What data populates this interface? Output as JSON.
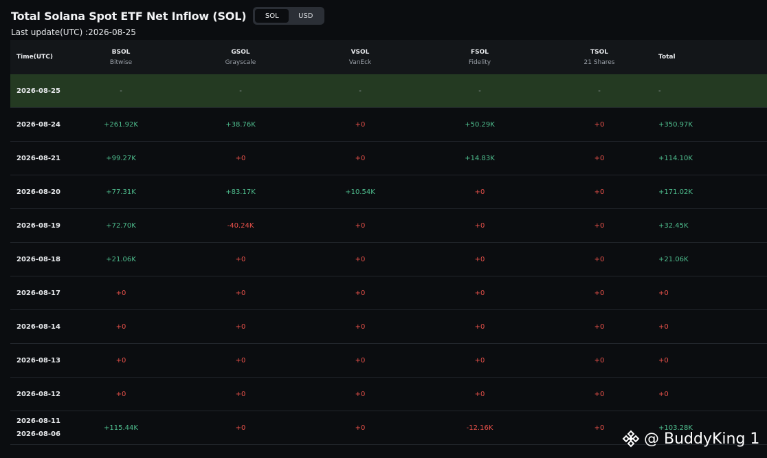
{
  "header": {
    "title": "Total Solana Spot ETF Net Inflow (SOL)",
    "toggle": [
      "SOL",
      "USD"
    ],
    "active_toggle": "SOL",
    "last_update": "Last update(UTC) :2026-08-25"
  },
  "table": {
    "columns": [
      {
        "ticker": "Time(UTC)",
        "issuer": ""
      },
      {
        "ticker": "BSOL",
        "issuer": "Bitwise"
      },
      {
        "ticker": "GSOL",
        "issuer": "Grayscale"
      },
      {
        "ticker": "VSOL",
        "issuer": "VanEck"
      },
      {
        "ticker": "FSOL",
        "issuer": "Fidelity"
      },
      {
        "ticker": "TSOL",
        "issuer": "21 Shares"
      },
      {
        "ticker": "Total",
        "issuer": ""
      }
    ],
    "rows": [
      {
        "date": "2026-08-25",
        "date2": "",
        "values": [
          "-",
          "-",
          "-",
          "-",
          "-",
          "-"
        ],
        "highlight": true
      },
      {
        "date": "2026-08-24",
        "date2": "",
        "values": [
          "+261.92K",
          "+38.76K",
          "+0",
          "+50.29K",
          "+0",
          "+350.97K"
        ]
      },
      {
        "date": "2026-08-21",
        "date2": "",
        "values": [
          "+99.27K",
          "+0",
          "+0",
          "+14.83K",
          "+0",
          "+114.10K"
        ]
      },
      {
        "date": "2026-08-20",
        "date2": "",
        "values": [
          "+77.31K",
          "+83.17K",
          "+10.54K",
          "+0",
          "+0",
          "+171.02K"
        ]
      },
      {
        "date": "2026-08-19",
        "date2": "",
        "values": [
          "+72.70K",
          "-40.24K",
          "+0",
          "+0",
          "+0",
          "+32.45K"
        ]
      },
      {
        "date": "2026-08-18",
        "date2": "",
        "values": [
          "+21.06K",
          "+0",
          "+0",
          "+0",
          "+0",
          "+21.06K"
        ]
      },
      {
        "date": "2026-08-17",
        "date2": "",
        "values": [
          "+0",
          "+0",
          "+0",
          "+0",
          "+0",
          "+0"
        ]
      },
      {
        "date": "2026-08-14",
        "date2": "",
        "values": [
          "+0",
          "+0",
          "+0",
          "+0",
          "+0",
          "+0"
        ]
      },
      {
        "date": "2026-08-13",
        "date2": "",
        "values": [
          "+0",
          "+0",
          "+0",
          "+0",
          "+0",
          "+0"
        ]
      },
      {
        "date": "2026-08-12",
        "date2": "",
        "values": [
          "+0",
          "+0",
          "+0",
          "+0",
          "+0",
          "+0"
        ]
      },
      {
        "date": "2026-08-11",
        "date2": "2026-08-06",
        "values": [
          "+115.44K",
          "+0",
          "+0",
          "-12.16K",
          "+0",
          "+103.28K"
        ]
      }
    ]
  },
  "colors": {
    "positive": "#4fbf8f",
    "zero": "#e8514a",
    "negative": "#e8514a",
    "highlight_row": "#243a22"
  },
  "watermark": {
    "text": "@ BuddyKing 1",
    "icon": "binance-logo-icon"
  }
}
